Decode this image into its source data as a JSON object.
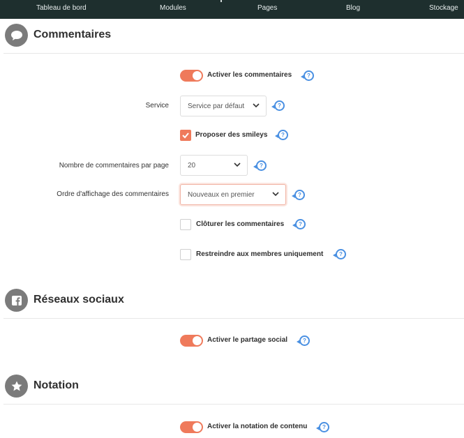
{
  "nav": {
    "items": [
      "Tableau de bord",
      "Modules",
      "Pages",
      "Blog",
      "Stockage"
    ]
  },
  "sections": {
    "comments": {
      "title": "Commentaires",
      "icon": "speech-bubble-icon",
      "enable_label": "Activer les commentaires",
      "enable_on": true,
      "service_label": "Service",
      "service_value": "Service par défaut",
      "smileys_label": "Proposer des smileys",
      "smileys_checked": true,
      "per_page_label": "Nombre de commentaires par page",
      "per_page_value": "20",
      "order_label": "Ordre d'affichage des commentaires",
      "order_value": "Nouveaux en premier",
      "close_label": "Clôturer les commentaires",
      "close_checked": false,
      "restrict_label": "Restreindre aux membres uniquement",
      "restrict_checked": false
    },
    "social": {
      "title": "Réseaux sociaux",
      "icon": "facebook-icon",
      "enable_label": "Activer le partage social",
      "enable_on": true
    },
    "rating": {
      "title": "Notation",
      "icon": "star-icon",
      "enable_label": "Activer la notation de contenu",
      "enable_on": true
    }
  },
  "help_glyph": "?",
  "colors": {
    "nav_bg": "#1e2f2e",
    "accent": "#ef7a5b",
    "help_blue": "#4a90e2",
    "section_icon_bg": "#7b7b7b"
  }
}
